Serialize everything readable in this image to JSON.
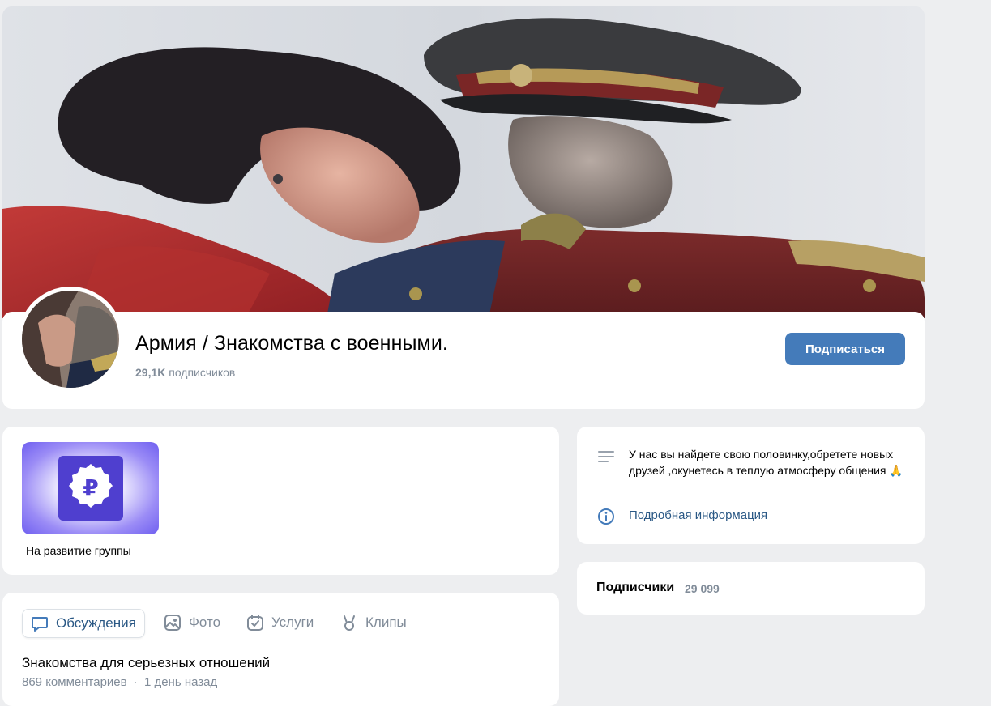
{
  "group": {
    "title": "Армия / Знакомства с военными.",
    "subscribers_short": "29,1K",
    "subscribers_word": "подписчиков",
    "subscribe_label": "Подписаться"
  },
  "donation": {
    "label": "На развитие группы",
    "symbol": "₽"
  },
  "tabs": [
    {
      "label": "Обсуждения",
      "icon": "discussion-icon",
      "active": true
    },
    {
      "label": "Фото",
      "icon": "photo-icon",
      "active": false
    },
    {
      "label": "Услуги",
      "icon": "services-icon",
      "active": false
    },
    {
      "label": "Клипы",
      "icon": "clips-icon",
      "active": false
    }
  ],
  "topic": {
    "title": "Знакомства для серьезных отношений",
    "comments": "869 комментариев",
    "separator": "·",
    "time": "1 день назад"
  },
  "description": {
    "text": "У нас вы найдете свою половинку,обретете новых друзей ,окунетесь в теплую атмосферу общения 🙏",
    "more_link": "Подробная информация"
  },
  "members": {
    "title": "Подписчики",
    "count": "29 099"
  },
  "colors": {
    "accent": "#447bba",
    "link": "#2a5885",
    "muted": "#818c99",
    "background": "#edeef0"
  }
}
